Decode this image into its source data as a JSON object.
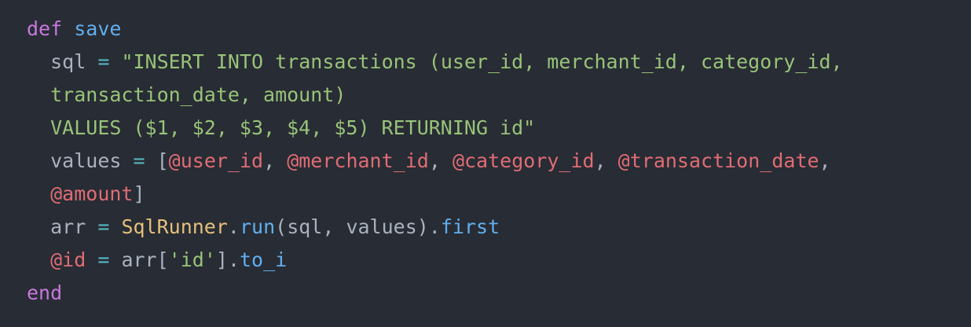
{
  "colors": {
    "background": "#282c34",
    "keyword": "#c678dd",
    "function": "#61afef",
    "string": "#98c379",
    "instance_variable": "#e06c75",
    "constant": "#e5c07b",
    "operator": "#56b6c2",
    "plain": "#abb2bf"
  },
  "code": {
    "lines": [
      {
        "indent": "",
        "tokens": [
          {
            "type": "keyword",
            "text": "def"
          },
          {
            "type": "plain",
            "text": " "
          },
          {
            "type": "function",
            "text": "save"
          }
        ]
      },
      {
        "indent": "  ",
        "tokens": [
          {
            "type": "plain",
            "text": "sql"
          },
          {
            "type": "plain",
            "text": " "
          },
          {
            "type": "operator",
            "text": "="
          },
          {
            "type": "plain",
            "text": " "
          },
          {
            "type": "string",
            "text": "\"INSERT INTO transactions (user_id, merchant_id, category_id,"
          }
        ]
      },
      {
        "indent": "  ",
        "tokens": [
          {
            "type": "string",
            "text": "transaction_date, amount)"
          }
        ]
      },
      {
        "indent": "  ",
        "tokens": [
          {
            "type": "string",
            "text": "VALUES ($1, $2, $3, $4, $5) RETURNING id\""
          }
        ]
      },
      {
        "indent": "  ",
        "tokens": [
          {
            "type": "plain",
            "text": "values"
          },
          {
            "type": "plain",
            "text": " "
          },
          {
            "type": "operator",
            "text": "="
          },
          {
            "type": "plain",
            "text": " "
          },
          {
            "type": "plain",
            "text": "["
          },
          {
            "type": "instance_variable",
            "text": "@user_id"
          },
          {
            "type": "plain",
            "text": ", "
          },
          {
            "type": "instance_variable",
            "text": "@merchant_id"
          },
          {
            "type": "plain",
            "text": ", "
          },
          {
            "type": "instance_variable",
            "text": "@category_id"
          },
          {
            "type": "plain",
            "text": ", "
          },
          {
            "type": "instance_variable",
            "text": "@transaction_date"
          },
          {
            "type": "plain",
            "text": ","
          }
        ]
      },
      {
        "indent": "  ",
        "tokens": [
          {
            "type": "instance_variable",
            "text": "@amount"
          },
          {
            "type": "plain",
            "text": "]"
          }
        ]
      },
      {
        "indent": "  ",
        "tokens": [
          {
            "type": "plain",
            "text": "arr"
          },
          {
            "type": "plain",
            "text": " "
          },
          {
            "type": "operator",
            "text": "="
          },
          {
            "type": "plain",
            "text": " "
          },
          {
            "type": "constant",
            "text": "SqlRunner"
          },
          {
            "type": "plain",
            "text": "."
          },
          {
            "type": "function",
            "text": "run"
          },
          {
            "type": "plain",
            "text": "(sql, values)."
          },
          {
            "type": "function",
            "text": "first"
          }
        ]
      },
      {
        "indent": "  ",
        "tokens": [
          {
            "type": "instance_variable",
            "text": "@id"
          },
          {
            "type": "plain",
            "text": " "
          },
          {
            "type": "operator",
            "text": "="
          },
          {
            "type": "plain",
            "text": " "
          },
          {
            "type": "plain",
            "text": "arr["
          },
          {
            "type": "string",
            "text": "'id'"
          },
          {
            "type": "plain",
            "text": "]."
          },
          {
            "type": "function",
            "text": "to_i"
          }
        ]
      },
      {
        "indent": "",
        "tokens": [
          {
            "type": "keyword",
            "text": "end"
          }
        ]
      }
    ]
  }
}
